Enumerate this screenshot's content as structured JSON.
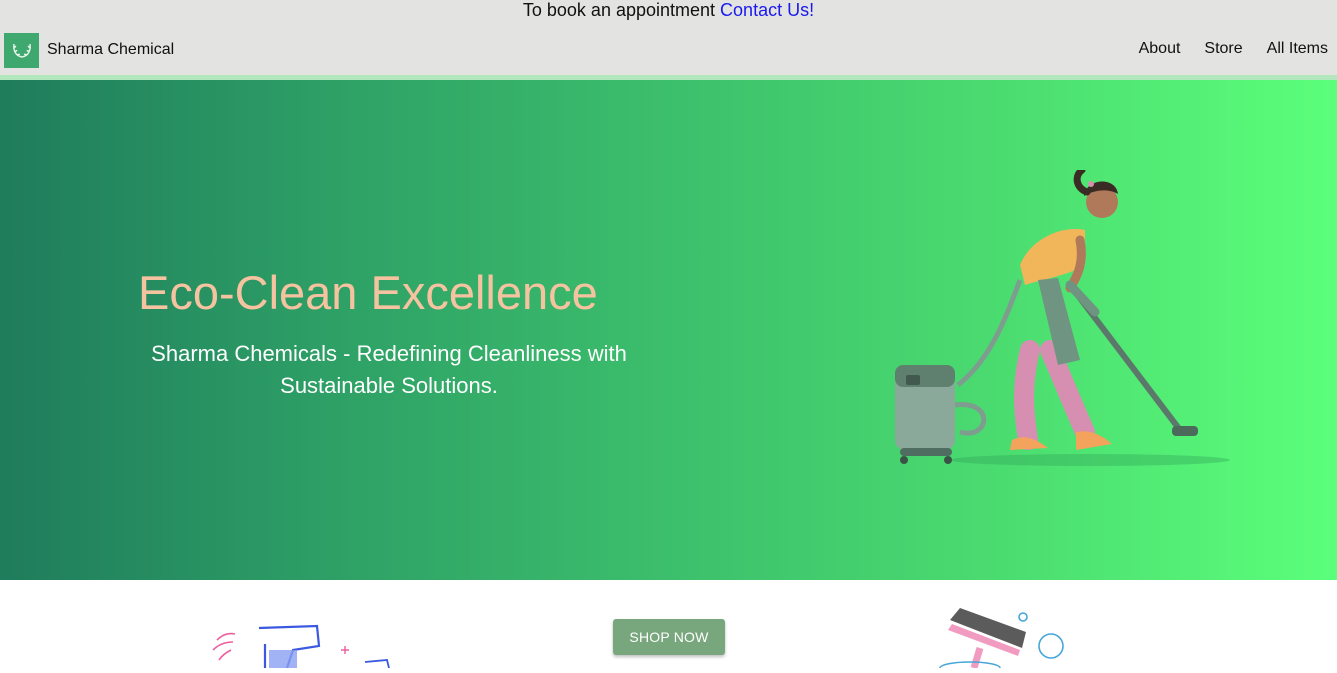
{
  "announcement": {
    "prefix": "To book an appointment",
    "link_label": "Contact Us!",
    "link_color": "#1a1aee"
  },
  "header": {
    "brand_name": "Sharma Chemical",
    "logo_icon": "laurel-wreath-icon",
    "background": "#e3e3e1",
    "nav": [
      {
        "label": "About"
      },
      {
        "label": "Store"
      },
      {
        "label": "All Items"
      }
    ]
  },
  "hero": {
    "title": "Eco-Clean Excellence",
    "subtitle": "Sharma Chemicals - Redefining Cleanliness with Sustainable Solutions.",
    "illustration": "woman-vacuuming-illustration",
    "gradient_start": "#1f7c5c",
    "gradient_end": "#5bff7b",
    "title_color": "#f6c3a0"
  },
  "cta": {
    "label": "SHOP NOW",
    "color": "#78a77e"
  },
  "decorations": {
    "left": "spray-bottle-icon",
    "right": "squeegee-bubbles-icon"
  }
}
